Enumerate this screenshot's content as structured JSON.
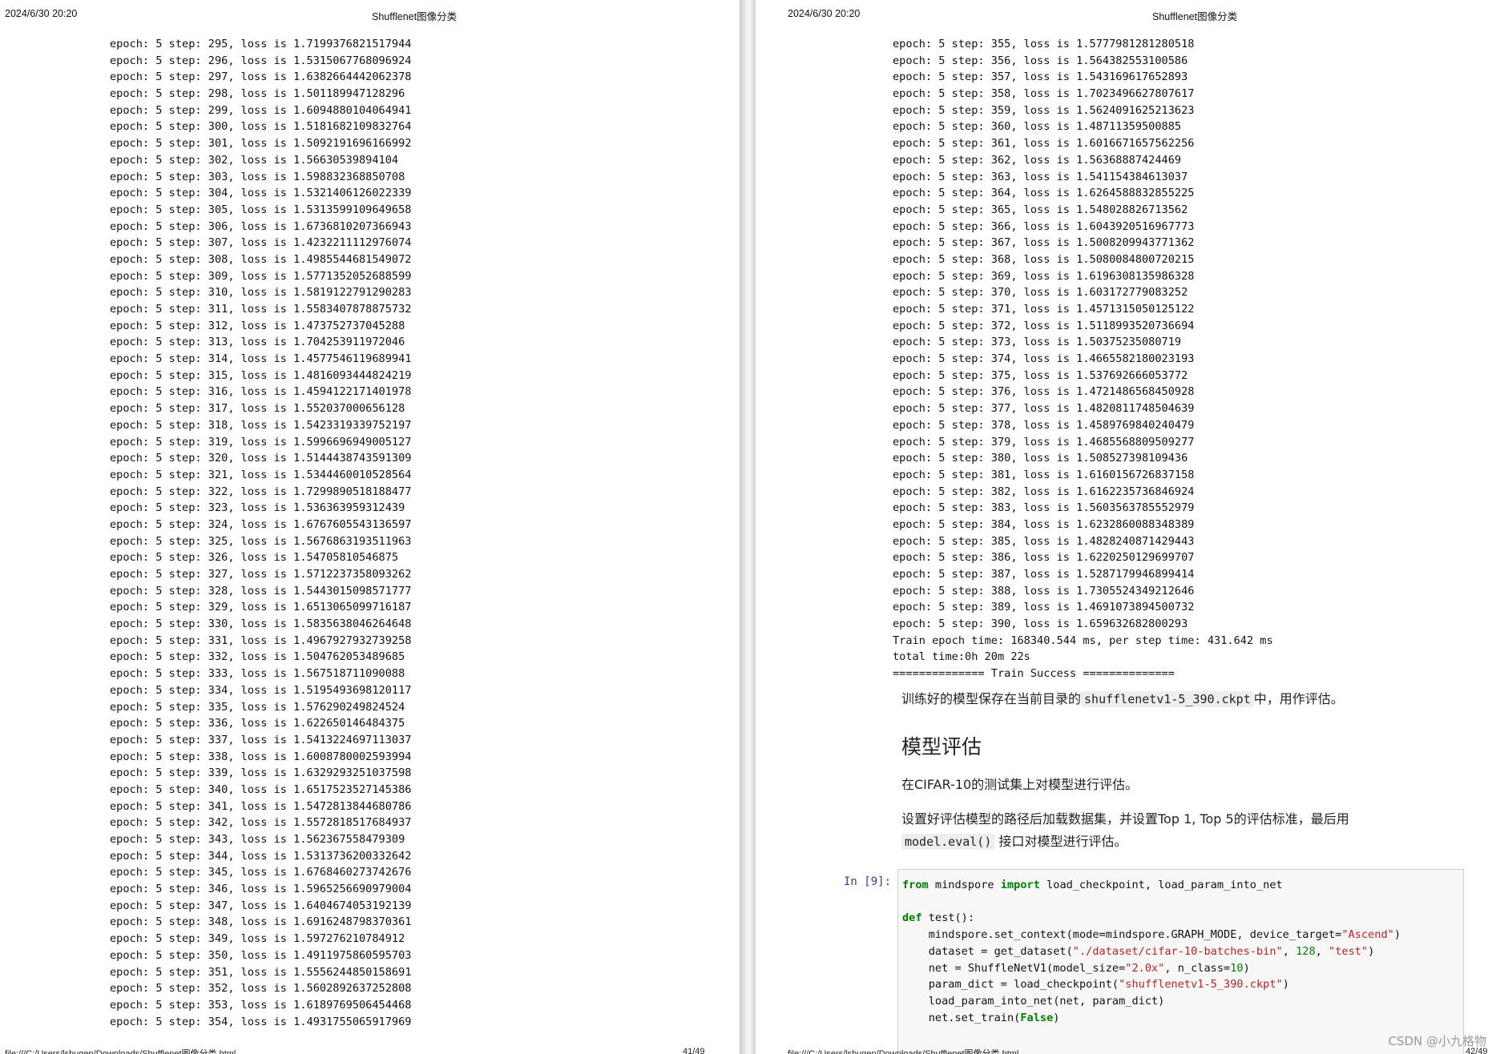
{
  "left_page": {
    "header": {
      "datetime": "2024/6/30 20:20",
      "title": "Shufflenet图像分类"
    },
    "log_lines": [
      "epoch: 5 step: 295, loss is 1.7199376821517944",
      "epoch: 5 step: 296, loss is 1.5315067768096924",
      "epoch: 5 step: 297, loss is 1.6382664442062378",
      "epoch: 5 step: 298, loss is 1.501189947128296",
      "epoch: 5 step: 299, loss is 1.6094880104064941",
      "epoch: 5 step: 300, loss is 1.5181682109832764",
      "epoch: 5 step: 301, loss is 1.5092191696166992",
      "epoch: 5 step: 302, loss is 1.56630539894104",
      "epoch: 5 step: 303, loss is 1.598832368850708",
      "epoch: 5 step: 304, loss is 1.5321406126022339",
      "epoch: 5 step: 305, loss is 1.5313599109649658",
      "epoch: 5 step: 306, loss is 1.6736810207366943",
      "epoch: 5 step: 307, loss is 1.4232211112976074",
      "epoch: 5 step: 308, loss is 1.4985544681549072",
      "epoch: 5 step: 309, loss is 1.5771352052688599",
      "epoch: 5 step: 310, loss is 1.5819122791290283",
      "epoch: 5 step: 311, loss is 1.5583407878875732",
      "epoch: 5 step: 312, loss is 1.473752737045288",
      "epoch: 5 step: 313, loss is 1.704253911972046",
      "epoch: 5 step: 314, loss is 1.4577546119689941",
      "epoch: 5 step: 315, loss is 1.4816093444824219",
      "epoch: 5 step: 316, loss is 1.4594122171401978",
      "epoch: 5 step: 317, loss is 1.552037000656128",
      "epoch: 5 step: 318, loss is 1.5423319339752197",
      "epoch: 5 step: 319, loss is 1.5996696949005127",
      "epoch: 5 step: 320, loss is 1.5144438743591309",
      "epoch: 5 step: 321, loss is 1.5344460010528564",
      "epoch: 5 step: 322, loss is 1.7299890518188477",
      "epoch: 5 step: 323, loss is 1.536363959312439",
      "epoch: 5 step: 324, loss is 1.6767605543136597",
      "epoch: 5 step: 325, loss is 1.5676863193511963",
      "epoch: 5 step: 326, loss is 1.54705810546875",
      "epoch: 5 step: 327, loss is 1.5712237358093262",
      "epoch: 5 step: 328, loss is 1.5443015098571777",
      "epoch: 5 step: 329, loss is 1.6513065099716187",
      "epoch: 5 step: 330, loss is 1.5835638046264648",
      "epoch: 5 step: 331, loss is 1.4967927932739258",
      "epoch: 5 step: 332, loss is 1.504762053489685",
      "epoch: 5 step: 333, loss is 1.567518711090088",
      "epoch: 5 step: 334, loss is 1.5195493698120117",
      "epoch: 5 step: 335, loss is 1.576290249824524",
      "epoch: 5 step: 336, loss is 1.622650146484375",
      "epoch: 5 step: 337, loss is 1.5413224697113037",
      "epoch: 5 step: 338, loss is 1.6008780002593994",
      "epoch: 5 step: 339, loss is 1.6329293251037598",
      "epoch: 5 step: 340, loss is 1.6517523527145386",
      "epoch: 5 step: 341, loss is 1.5472813844680786",
      "epoch: 5 step: 342, loss is 1.5572818517684937",
      "epoch: 5 step: 343, loss is 1.562367558479309",
      "epoch: 5 step: 344, loss is 1.5313736200332642",
      "epoch: 5 step: 345, loss is 1.6768460273742676",
      "epoch: 5 step: 346, loss is 1.5965256690979004",
      "epoch: 5 step: 347, loss is 1.6404674053192139",
      "epoch: 5 step: 348, loss is 1.6916248798370361",
      "epoch: 5 step: 349, loss is 1.597276210784912",
      "epoch: 5 step: 350, loss is 1.4911975860595703",
      "epoch: 5 step: 351, loss is 1.5556244850158691",
      "epoch: 5 step: 352, loss is 1.5602892637252808",
      "epoch: 5 step: 353, loss is 1.6189769506454468",
      "epoch: 5 step: 354, loss is 1.4931755065917969"
    ],
    "footer": {
      "path": "file:///C:/Users/lshugen/Downloads/Shufflenet图像分类.html",
      "page": "41/49"
    }
  },
  "right_page": {
    "header": {
      "datetime": "2024/6/30 20:20",
      "title": "Shufflenet图像分类"
    },
    "log_lines": [
      "epoch: 5 step: 355, loss is 1.5777981281280518",
      "epoch: 5 step: 356, loss is 1.564382553100586",
      "epoch: 5 step: 357, loss is 1.543169617652893",
      "epoch: 5 step: 358, loss is 1.7023496627807617",
      "epoch: 5 step: 359, loss is 1.5624091625213623",
      "epoch: 5 step: 360, loss is 1.48711359500885",
      "epoch: 5 step: 361, loss is 1.6016671657562256",
      "epoch: 5 step: 362, loss is 1.56368887424469",
      "epoch: 5 step: 363, loss is 1.541154384613037",
      "epoch: 5 step: 364, loss is 1.6264588832855225",
      "epoch: 5 step: 365, loss is 1.548028826713562",
      "epoch: 5 step: 366, loss is 1.6043920516967773",
      "epoch: 5 step: 367, loss is 1.5008209943771362",
      "epoch: 5 step: 368, loss is 1.5080084800720215",
      "epoch: 5 step: 369, loss is 1.6196308135986328",
      "epoch: 5 step: 370, loss is 1.603172779083252",
      "epoch: 5 step: 371, loss is 1.4571315050125122",
      "epoch: 5 step: 372, loss is 1.5118993520736694",
      "epoch: 5 step: 373, loss is 1.50375235080719",
      "epoch: 5 step: 374, loss is 1.4665582180023193",
      "epoch: 5 step: 375, loss is 1.537692666053772",
      "epoch: 5 step: 376, loss is 1.4721486568450928",
      "epoch: 5 step: 377, loss is 1.4820811748504639",
      "epoch: 5 step: 378, loss is 1.4589769840240479",
      "epoch: 5 step: 379, loss is 1.4685568809509277",
      "epoch: 5 step: 380, loss is 1.508527398109436",
      "epoch: 5 step: 381, loss is 1.6160156726837158",
      "epoch: 5 step: 382, loss is 1.6162235736846924",
      "epoch: 5 step: 383, loss is 1.5603563785552979",
      "epoch: 5 step: 384, loss is 1.6232860088348389",
      "epoch: 5 step: 385, loss is 1.4828240871429443",
      "epoch: 5 step: 386, loss is 1.6220250129699707",
      "epoch: 5 step: 387, loss is 1.5287179946899414",
      "epoch: 5 step: 388, loss is 1.7305524349212646",
      "epoch: 5 step: 389, loss is 1.4691073894500732",
      "epoch: 5 step: 390, loss is 1.659632682800293",
      "Train epoch time: 168340.544 ms, per step time: 431.642 ms",
      "total time:0h 20m 22s",
      "============== Train Success =============="
    ],
    "saved_note": {
      "before": "训练好的模型保存在当前目录的",
      "code": "shufflenetv1-5_390.ckpt",
      "after": "中，用作评估。"
    },
    "section_heading": "模型评估",
    "para_cifar": "在CIFAR-10的测试集上对模型进行评估。",
    "para_eval": {
      "line1": "设置好评估模型的路径后加载数据集，并设置Top 1, Top 5的评估标准，最后用",
      "code": "model.eval()",
      "after": "接口对模型进行评估。"
    },
    "code_cell": {
      "prompt": "In [9]:",
      "import_tokens": {
        "kw_from": "from",
        "module": " mindspore ",
        "kw_import": "import",
        "names": " load_checkpoint, load_param_into_net"
      },
      "def_tokens": {
        "kw_def": "def",
        "sig": " test():"
      },
      "line_context": {
        "pre": "    mindspore.set_context(mode=mindspore.GRAPH_MODE, device_target=",
        "str": "\"Ascend\"",
        "post": ")"
      },
      "line_dataset": {
        "pre": "    dataset = get_dataset(",
        "str1": "\"./dataset/cifar-10-batches-bin\"",
        "mid": ", ",
        "num": "128",
        "mid2": ", ",
        "str2": "\"test\"",
        "post": ")"
      },
      "line_net": {
        "pre": "    net = ShuffleNetV1(model_size=",
        "str": "\"2.0x\"",
        "mid": ", n_class=",
        "num": "10",
        "post": ")"
      },
      "line_param": {
        "pre": "    param_dict = load_checkpoint(",
        "str": "\"shufflenetv1-5_390.ckpt\"",
        "post": ")"
      },
      "line_load": "    load_param_into_net(net, param_dict)",
      "line_train": {
        "pre": "    net.set_train(",
        "kw": "False",
        "post": ")"
      }
    },
    "footer": {
      "path": "file:///C:/Users/lshugen/Downloads/Shufflenet图像分类.html",
      "page": "42/49"
    }
  },
  "watermark": "CSDN @小九格物"
}
